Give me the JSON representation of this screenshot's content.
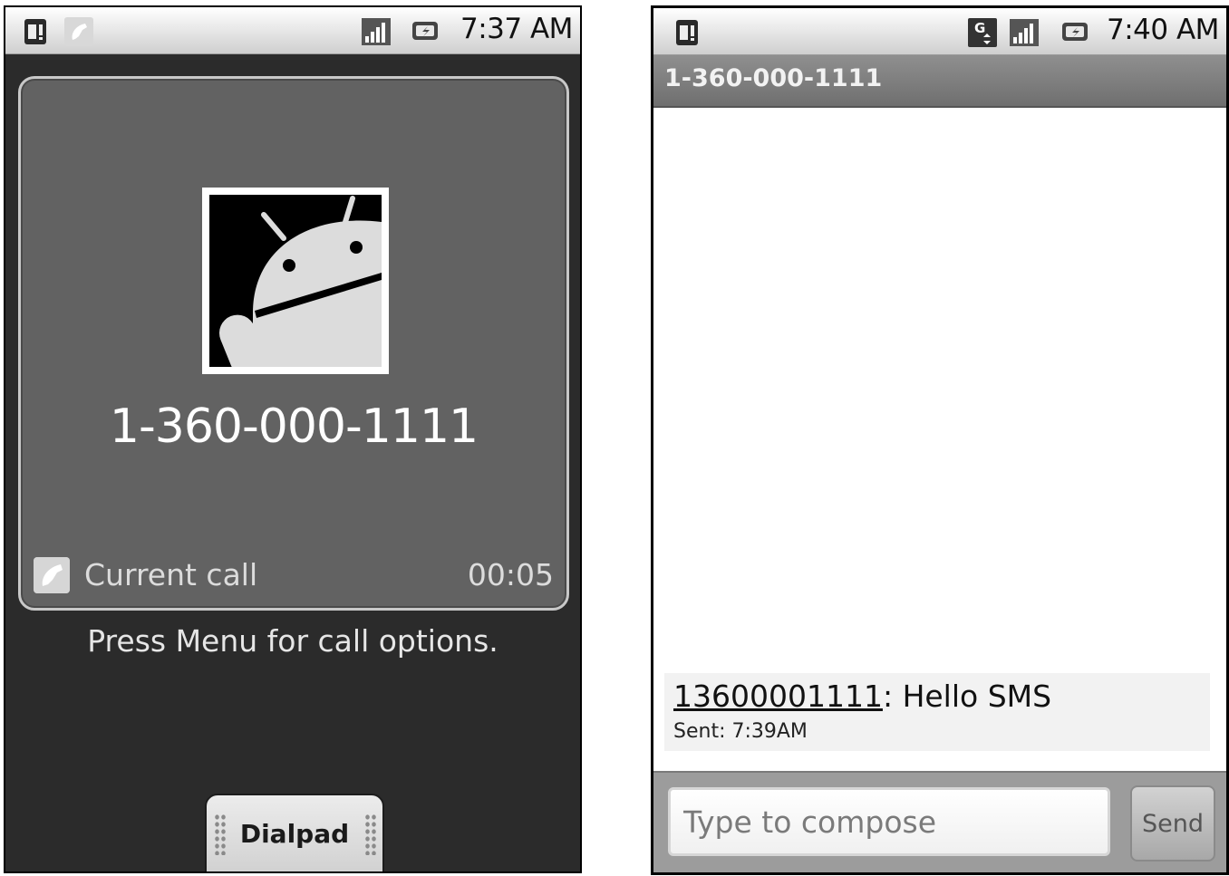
{
  "call_screen": {
    "status_bar": {
      "time": "7:37 AM",
      "icons": [
        "sim-alert-icon",
        "phone-active-icon",
        "signal-icon",
        "battery-icon"
      ]
    },
    "caller_number": "1-360-000-1111",
    "avatar": "android-robot-icon",
    "call_status_label": "Current call",
    "call_timer": "00:05",
    "hint": "Press Menu for call options.",
    "dialpad_label": "Dialpad"
  },
  "sms_screen": {
    "status_bar": {
      "time": "7:40 AM",
      "icons": [
        "sim-alert-icon",
        "data-g-icon",
        "signal-icon",
        "battery-icon"
      ]
    },
    "title": "1-360-000-1111",
    "message": {
      "sender": "13600001111",
      "separator": ":",
      "body": " Hello SMS",
      "sent": "Sent: 7:39AM"
    },
    "compose": {
      "placeholder": "Type to compose",
      "send_label": "Send"
    }
  },
  "colors": {
    "call_bg": "#2b2b2b",
    "card_bg": "#626262",
    "title_bar": "#7d7d7d",
    "compose_bar": "#9c9c9c"
  }
}
